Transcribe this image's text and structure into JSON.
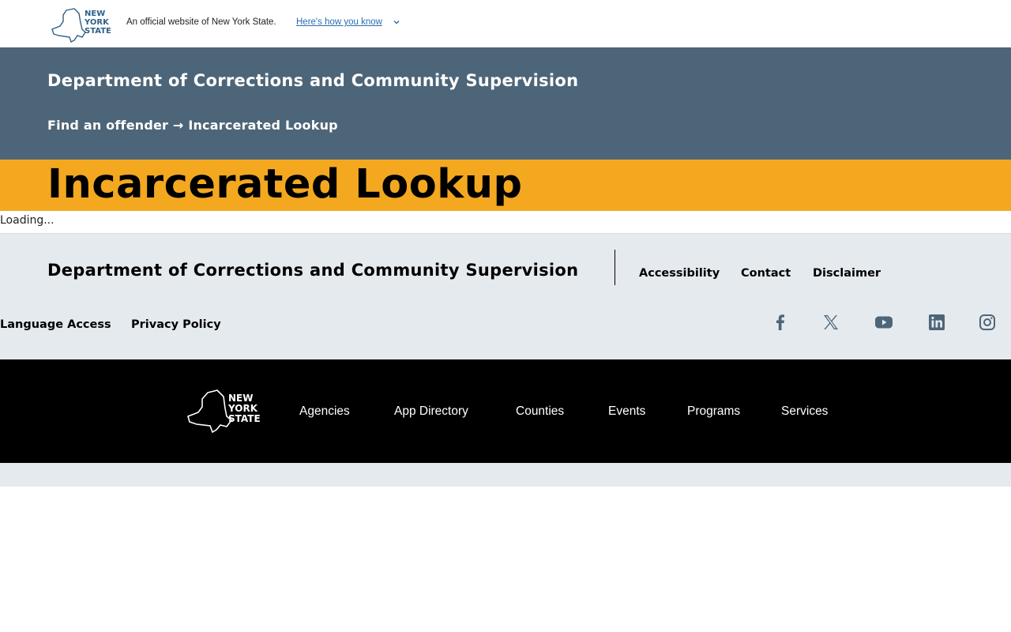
{
  "gov_banner": {
    "logo_text": [
      "NEW",
      "YORK",
      "STATE"
    ],
    "official_text": "An official website of New York State.",
    "how_you_know_link": "Here's how you know",
    "chevron_icon": "chevron-down-icon"
  },
  "header": {
    "agency_title": "Department of Corrections and Community Supervision",
    "breadcrumb": {
      "parent": "Find an offender",
      "arrow": "→",
      "current": "Incarcerated Lookup"
    }
  },
  "page": {
    "title": "Incarcerated Lookup",
    "loading_text": "Loading..."
  },
  "agency_footer": {
    "title": "Department of Corrections and Community Supervision",
    "links_row1": [
      "Accessibility",
      "Contact",
      "Disclaimer"
    ],
    "links_row2": [
      "Language Access",
      "Privacy Policy"
    ],
    "social_icons": [
      "facebook-icon",
      "x-twitter-icon",
      "youtube-icon",
      "linkedin-icon",
      "instagram-icon"
    ],
    "social_color": "#4d6578"
  },
  "global_footer": {
    "logo_text": [
      "NEW",
      "YORK",
      "STATE"
    ],
    "links": [
      "Agencies",
      "App Directory",
      "Counties",
      "Events",
      "Programs",
      "Services"
    ]
  },
  "colors": {
    "header_bg": "#4d6578",
    "title_band_bg": "#f3a820",
    "footer_bg": "#e5eaef",
    "global_footer_bg": "#000000",
    "link_blue": "#2a6db0"
  }
}
